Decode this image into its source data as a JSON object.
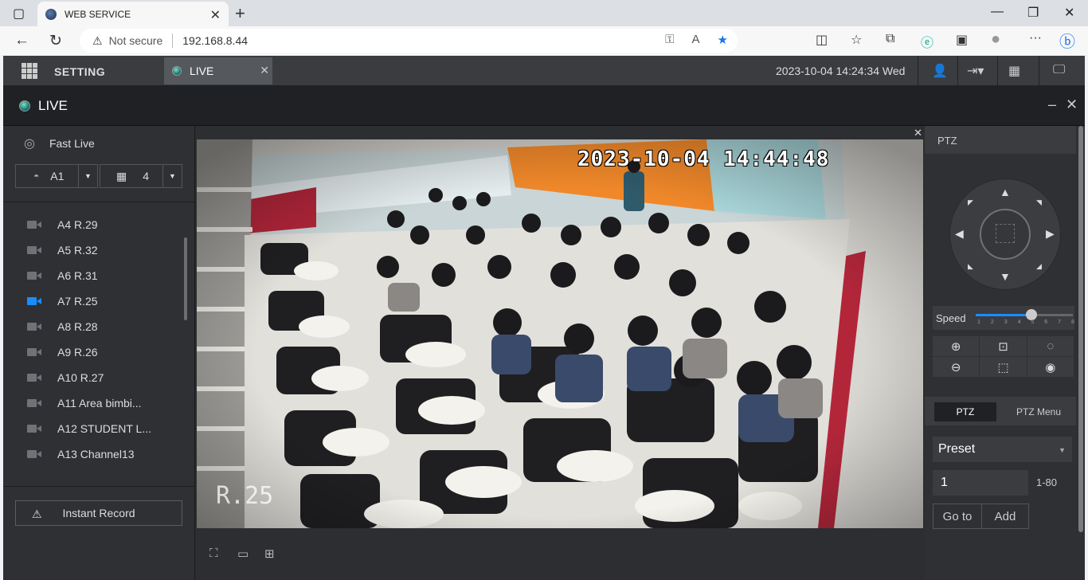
{
  "browser": {
    "tab_title": "WEB SERVICE",
    "security": "Not secure",
    "url": "192.168.8.44",
    "icons": [
      "back-icon",
      "refresh-icon",
      "key-icon",
      "read-aloud-icon",
      "favorite-star-icon",
      "split-screen-icon",
      "favorites-icon",
      "collections-icon",
      "performance-icon",
      "browser-essentials-icon",
      "profile-icon",
      "more-icon",
      "bing-icon"
    ]
  },
  "app": {
    "menu_label": "SETTING",
    "live_tab": "LIVE",
    "datetime": "2023-10-04 14:24:34 Wed",
    "panel_title": "LIVE"
  },
  "sidebar": {
    "fast_live": "Fast Live",
    "group_select": "A1",
    "split_select": "4",
    "channels": [
      {
        "label": "A4 R.29",
        "active": false
      },
      {
        "label": "A5 R.32",
        "active": false
      },
      {
        "label": "A6 R.31",
        "active": false
      },
      {
        "label": "A7 R.25",
        "active": true
      },
      {
        "label": "A8 R.28",
        "active": false
      },
      {
        "label": "A9 R.26",
        "active": false
      },
      {
        "label": "A10 R.27",
        "active": false
      },
      {
        "label": "A11 Area bimbi...",
        "active": false
      },
      {
        "label": "A12 STUDENT L...",
        "active": false
      },
      {
        "label": "A13 Channel13",
        "active": false
      }
    ],
    "instant_record": "Instant Record"
  },
  "video": {
    "osd_time": "2023-10-04 14:44:48",
    "osd_name": "R.25"
  },
  "ptz": {
    "header": "PTZ",
    "speed_label": "Speed",
    "speed_value": 5,
    "speed_ticks": [
      "1",
      "2",
      "3",
      "4",
      "5",
      "6",
      "7",
      "8"
    ],
    "tab_ptz": "PTZ",
    "tab_menu": "PTZ Menu",
    "preset_label": "Preset",
    "preset_number": "1",
    "preset_range": "1-80",
    "goto_label": "Go to",
    "add_label": "Add"
  },
  "colors": {
    "accent": "#1a8cff",
    "app_bg": "#2b2d30",
    "wall_orange": "#f0882a",
    "wall_red": "#b3263a"
  }
}
